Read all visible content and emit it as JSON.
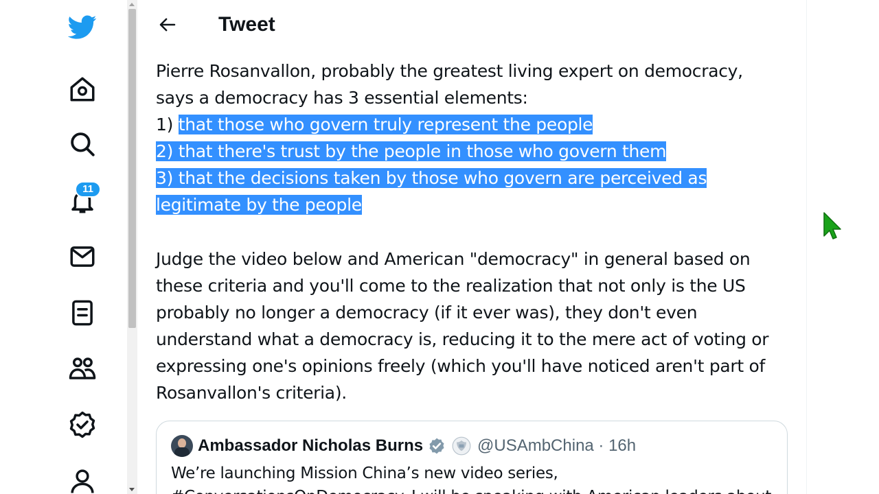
{
  "nav": {
    "items": [
      {
        "icon": "twitter-logo-icon"
      },
      {
        "icon": "home-icon"
      },
      {
        "icon": "search-icon"
      },
      {
        "icon": "bell-icon",
        "badge": "11"
      },
      {
        "icon": "mail-icon"
      },
      {
        "icon": "lists-icon"
      },
      {
        "icon": "communities-icon"
      },
      {
        "icon": "verified-icon"
      },
      {
        "icon": "profile-icon"
      }
    ],
    "notification_badge": "11"
  },
  "header": {
    "title": "Tweet"
  },
  "tweet": {
    "line1": "Pierre Rosanvallon, probably the greatest living expert on democracy,",
    "line2": "says a democracy has 3 essential elements:",
    "item1_prefix": "1) ",
    "item1_highlight": "that those who govern truly represent the people",
    "item2": "2) that there's trust by the people in those who govern them",
    "item3a": "3) that the decisions taken by those who govern are perceived as",
    "item3b": "legitimate by the people",
    "para2_lines": [
      "Judge the video below and American \"democracy\" in general based on",
      "these criteria and you'll come to the realization that not only is the US",
      "probably no longer a democracy (if it ever was), they don't even",
      "understand what a democracy is, reducing it to the mere act of voting or",
      "expressing one's opinions freely (which you'll have noticed aren't part of",
      "Rosanvallon's criteria)."
    ]
  },
  "quote": {
    "name": "Ambassador Nicholas Burns",
    "handle_time": "@USAmbChina · 16h",
    "text_line1": "We’re launching Mission China’s new video series,",
    "text_line2": "#ConversationsOnDemocracy. I will be speaking with American leaders about"
  },
  "colors": {
    "brand": "#1d9bf0",
    "selection": "#3390ff",
    "cursor": "#1aa31a"
  }
}
